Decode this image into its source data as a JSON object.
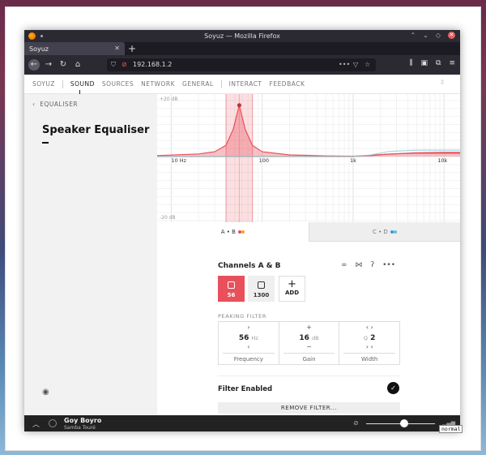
{
  "browser": {
    "title": "Soyuz — Mozilla Firefox",
    "tab_label": "Soyuz",
    "url": "192.168.1.2"
  },
  "app_nav": {
    "brand": "SOYUZ",
    "items": [
      "SOUND",
      "SOURCES",
      "NETWORK",
      "GENERAL",
      "INTERACT",
      "FEEDBACK"
    ],
    "active": "SOUND"
  },
  "sidebar": {
    "breadcrumb": "EQUALISER",
    "title": "Speaker Equaliser"
  },
  "chart_data": {
    "type": "line",
    "x_scale": "log",
    "xlim": [
      7,
      15000
    ],
    "ylim": [
      -20,
      20
    ],
    "x_ticks": [
      "10 Hz",
      "100",
      "1k",
      "10k"
    ],
    "y_labels": [
      "+20 dB",
      "-20 dB"
    ],
    "selected_band": {
      "center_hz": 56,
      "from_hz": 40,
      "to_hz": 78
    },
    "series": [
      {
        "color": "#e8505b",
        "fill": true,
        "x": [
          7,
          20,
          30,
          40,
          48,
          56,
          65,
          78,
          100,
          200,
          500,
          1000,
          2000,
          5000,
          10000,
          15000
        ],
        "y": [
          0.3,
          0.8,
          1.5,
          3.5,
          8.5,
          16,
          8.5,
          3.5,
          1.5,
          0.5,
          0.2,
          0.1,
          0.6,
          1.2,
          1.3,
          1.3
        ]
      },
      {
        "color": "#e8505b",
        "fill": false,
        "x": [
          7,
          100,
          1000,
          1500,
          2500,
          5000,
          10000,
          15000
        ],
        "y": [
          0,
          0,
          0,
          0.2,
          0.8,
          1.0,
          1.0,
          1.0
        ]
      },
      {
        "color": "#8fd4dc",
        "fill": false,
        "x": [
          7,
          100,
          1000,
          1500,
          2500,
          5000,
          10000,
          15000
        ],
        "y": [
          0,
          0,
          0,
          0.4,
          1.6,
          2.0,
          2.0,
          2.0
        ]
      }
    ]
  },
  "channel_tabs": [
    {
      "label": "A • B",
      "active": true,
      "dots": [
        "#e8505b",
        "#f5a623"
      ]
    },
    {
      "label": "C • D",
      "active": false,
      "dots": [
        "#4a90e2",
        "#5bc0de"
      ]
    }
  ],
  "channel": {
    "title": "Channels A & B",
    "filters": [
      {
        "label": "56",
        "selected": true
      },
      {
        "label": "1300",
        "selected": false
      }
    ],
    "add_label": "ADD"
  },
  "filter": {
    "type_label": "PEAKING FILTER",
    "frequency": {
      "value": "56",
      "unit": "Hz",
      "label": "Frequency"
    },
    "gain": {
      "value": "16",
      "unit": "dB",
      "label": "Gain"
    },
    "width": {
      "prefix": "Q",
      "value": "2",
      "label": "Width"
    },
    "enabled_label": "Filter Enabled",
    "enabled": true,
    "remove_label": "REMOVE FILTER..."
  },
  "player": {
    "track": "Goy Boyro",
    "artist": "Samba Touré",
    "volume": 0.55,
    "mode": "normal"
  }
}
